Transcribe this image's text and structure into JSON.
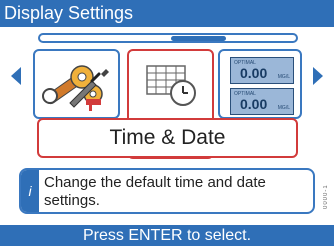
{
  "header": {
    "title": "Display Settings"
  },
  "carousel": {
    "selected_label": "Time & Date",
    "items": [
      {
        "name": "tools"
      },
      {
        "name": "time-date"
      },
      {
        "name": "display"
      }
    ]
  },
  "info": {
    "icon": "i",
    "text": "Change the default time and date settings."
  },
  "footer": {
    "prompt": "Press ENTER to select."
  },
  "display_panels": {
    "value1": "0.00",
    "value2": "0.00",
    "small_text1": "OPTIMAL",
    "small_text2": "OPTIMAL",
    "unit1": "MG/L",
    "unit2": "MG/L"
  },
  "side_code": "0000-1",
  "colors": {
    "accent": "#2f6fb7",
    "selection": "#d23b3b"
  }
}
